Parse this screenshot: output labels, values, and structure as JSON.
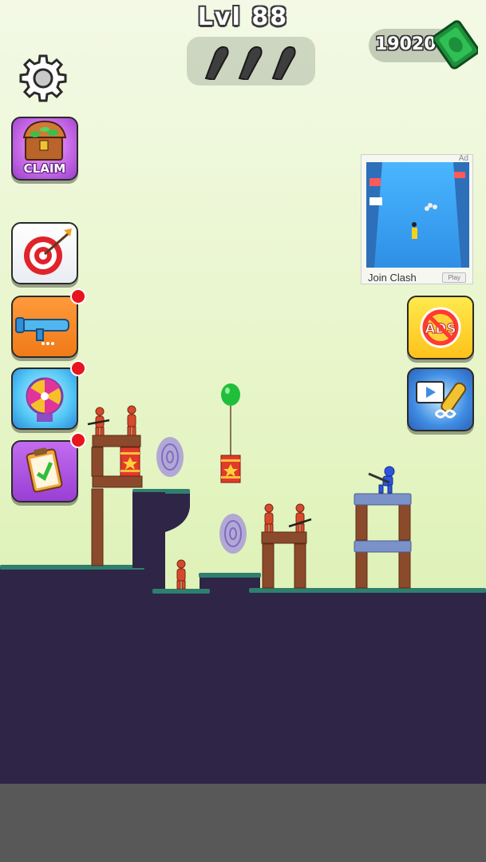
{
  "hud": {
    "level_label": "Lvl 88",
    "bullets_remaining": 3,
    "money": "19020"
  },
  "left_menu": {
    "claim_label": "CLAIM",
    "buttons": [
      "target-button",
      "weapon-button",
      "spin-wheel-button",
      "tasks-button"
    ]
  },
  "ad": {
    "mark": "Ad",
    "caption": "Join Clash",
    "play_label": "Play"
  },
  "icons": {
    "settings": "gear-icon",
    "cash": "cash-stack-icon",
    "bullet": "bullet-icon",
    "no_ads": "no-ads-icon",
    "video": "video-rocket-icon"
  },
  "colors": {
    "ground": "#2e2547",
    "grass": "#2f7f6f",
    "wood": "#8b4a2b",
    "enemy": "#d64a2c",
    "player": "#2b55e0",
    "barrel": "#e23a2a",
    "balloon": "#1fbf3a",
    "portal": "#a99ad8"
  }
}
